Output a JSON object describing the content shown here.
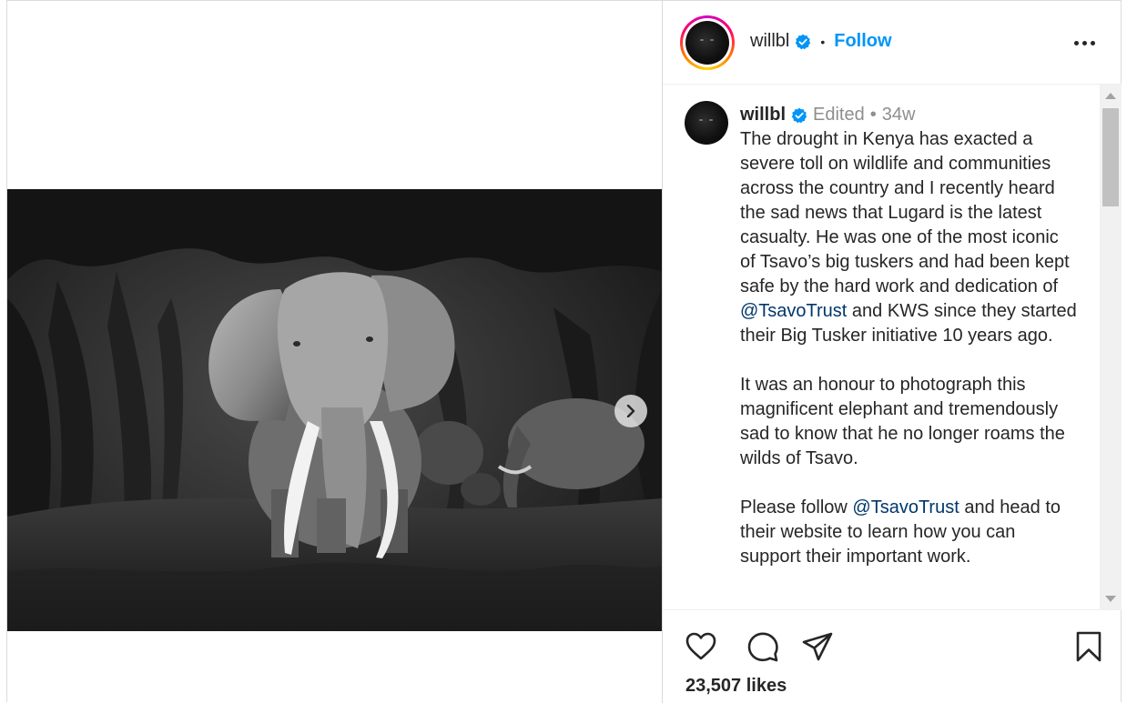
{
  "post": {
    "username": "willbl",
    "header_separator": "•",
    "follow_label": "Follow",
    "caption": {
      "username": "willbl",
      "edited_label": "Edited",
      "separator": "•",
      "age": "34w",
      "paragraphs": [
        [
          {
            "text": "The drought in Kenya has exacted a severe toll on wildlife and communities across the country and I recently heard the sad news that Lugard is the latest casualty. He was one of the most iconic of Tsavo’s big tuskers and had been kept safe by the hard work and dedication of "
          },
          {
            "text": "@TsavoTrust",
            "mention": true
          },
          {
            "text": " and KWS since they started their Big Tusker initiative 10 years ago."
          }
        ],
        [
          {
            "text": "It was an honour to photograph this magnificent elephant and tremendously sad to know that he no longer roams the wilds of Tsavo."
          }
        ],
        [
          {
            "text": "Please follow "
          },
          {
            "text": "@TsavoTrust",
            "mention": true
          },
          {
            "text": " and head to their website to learn how you can support their important work."
          }
        ]
      ]
    },
    "likes": "23,507 likes"
  },
  "icons": {
    "verified": "verified-badge-icon",
    "more": "more-options-icon",
    "next": "chevron-right-icon",
    "like": "heart-icon",
    "comment": "comment-icon",
    "share": "paper-plane-icon",
    "save": "bookmark-icon"
  },
  "colors": {
    "accent": "#0095f6",
    "mention": "#00376b",
    "meta_text": "#8e8e8e",
    "text": "#262626"
  }
}
